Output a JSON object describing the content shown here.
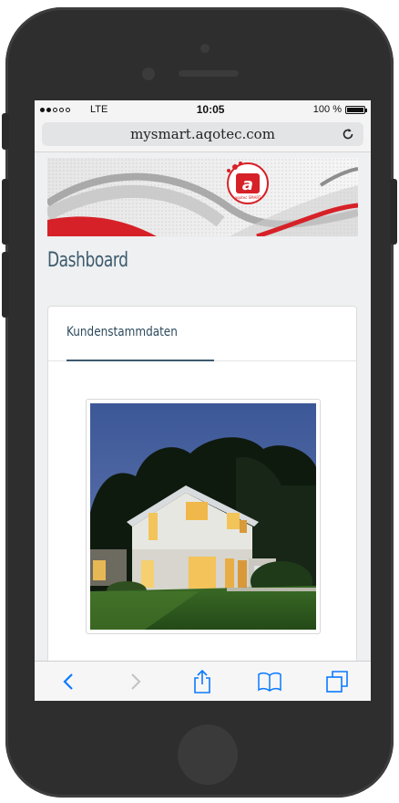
{
  "status_bar": {
    "carrier": "LTE",
    "time": "10:05",
    "battery": "100 %"
  },
  "browser": {
    "url": "mysmart.aqotec.com"
  },
  "page": {
    "title": "Dashboard",
    "tabs": [
      {
        "label": "Kundenstammdaten",
        "active": true
      }
    ],
    "logo_text": "aqotec SMART"
  },
  "toolbar": {
    "back": "back-icon",
    "forward": "forward-icon",
    "share": "share-icon",
    "bookmarks": "bookmarks-icon",
    "tabs": "tabs-icon"
  },
  "colors": {
    "accent": "#3c5a6e",
    "ios_blue": "#0a7aff",
    "brand_red": "#d62128"
  }
}
